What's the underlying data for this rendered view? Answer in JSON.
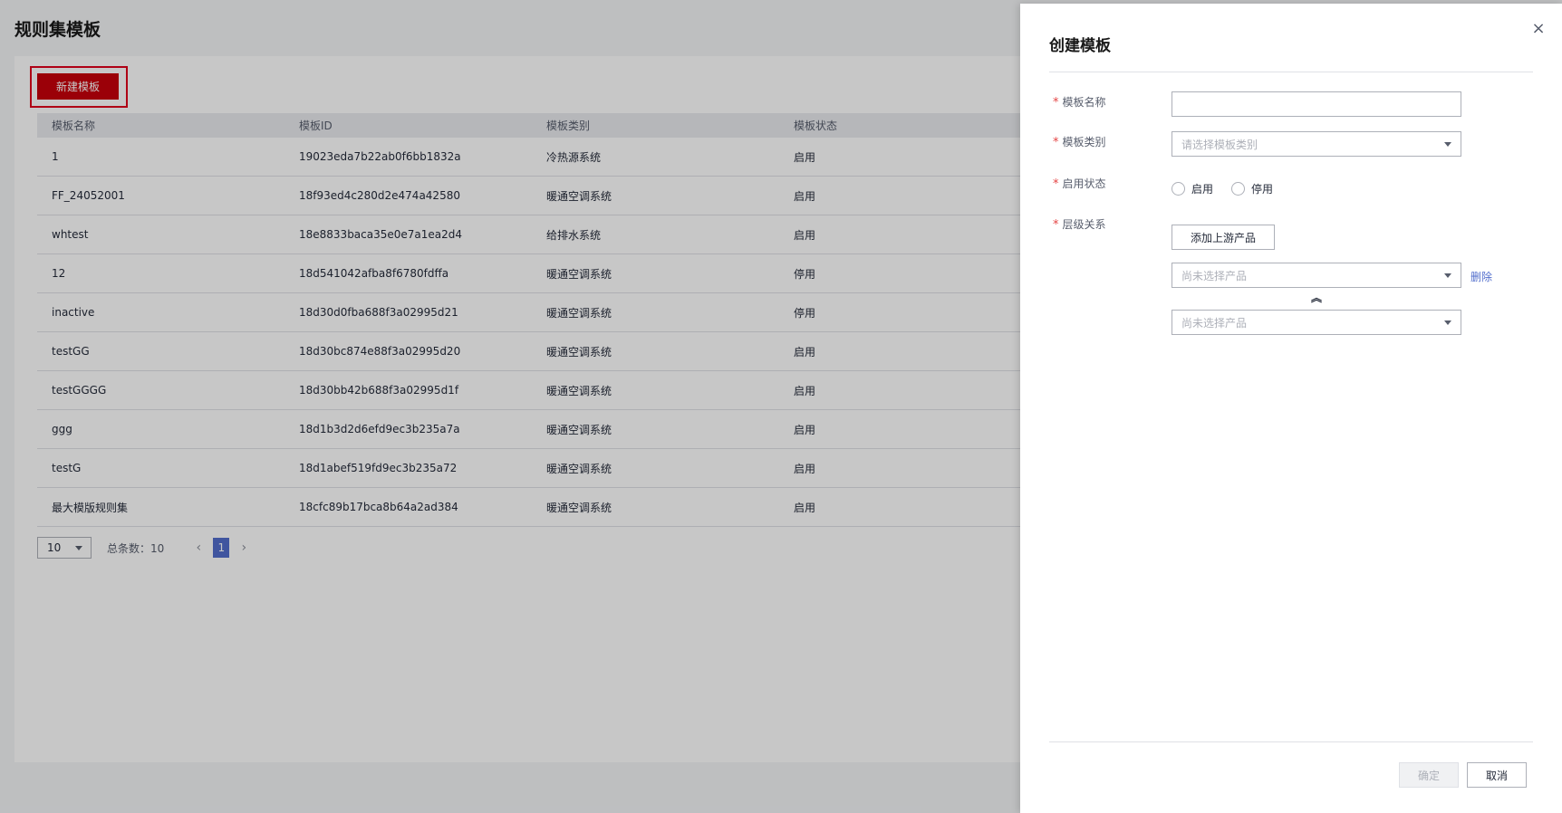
{
  "page": {
    "title": "规则集模板",
    "new_button": "新建模板"
  },
  "table": {
    "headers": [
      "模板名称",
      "模板ID",
      "模板类别",
      "模板状态"
    ],
    "rows": [
      [
        "1",
        "19023eda7b22ab0f6bb1832a",
        "冷热源系统",
        "启用"
      ],
      [
        "FF_24052001",
        "18f93ed4c280d2e474a42580",
        "暖通空调系统",
        "启用"
      ],
      [
        "whtest",
        "18e8833baca35e0e7a1ea2d4",
        "给排水系统",
        "启用"
      ],
      [
        "12",
        "18d541042afba8f6780fdffa",
        "暖通空调系统",
        "停用"
      ],
      [
        "inactive",
        "18d30d0fba688f3a02995d21",
        "暖通空调系统",
        "停用"
      ],
      [
        "testGG",
        "18d30bc874e88f3a02995d20",
        "暖通空调系统",
        "启用"
      ],
      [
        "testGGGG",
        "18d30bb42b688f3a02995d1f",
        "暖通空调系统",
        "启用"
      ],
      [
        "ggg",
        "18d1b3d2d6efd9ec3b235a7a",
        "暖通空调系统",
        "启用"
      ],
      [
        "testG",
        "18d1abef519fd9ec3b235a72",
        "暖通空调系统",
        "启用"
      ],
      [
        "最大模版规则集",
        "18cfc89b17bca8b64a2ad384",
        "暖通空调系统",
        "启用"
      ]
    ]
  },
  "pagination": {
    "page_size": "10",
    "total": "总条数：10",
    "current_page": "1",
    "prev": "‹",
    "next": "›"
  },
  "drawer": {
    "title": "创建模板",
    "close": "×",
    "required_mark": "*",
    "fields": {
      "name_label": "模板名称",
      "name_value": "",
      "category_label": "模板类别",
      "category_placeholder": "请选择模板类别",
      "status_label": "启用状态",
      "status_options": [
        "启用",
        "停用"
      ],
      "hierarchy_label": "层级关系",
      "add_upstream_button": "添加上游产品",
      "product_placeholder_1": "尚未选择产品",
      "product_placeholder_2": "尚未选择产品",
      "delete_link": "删除"
    },
    "footer": {
      "ok": "确定",
      "cancel": "取消"
    }
  }
}
